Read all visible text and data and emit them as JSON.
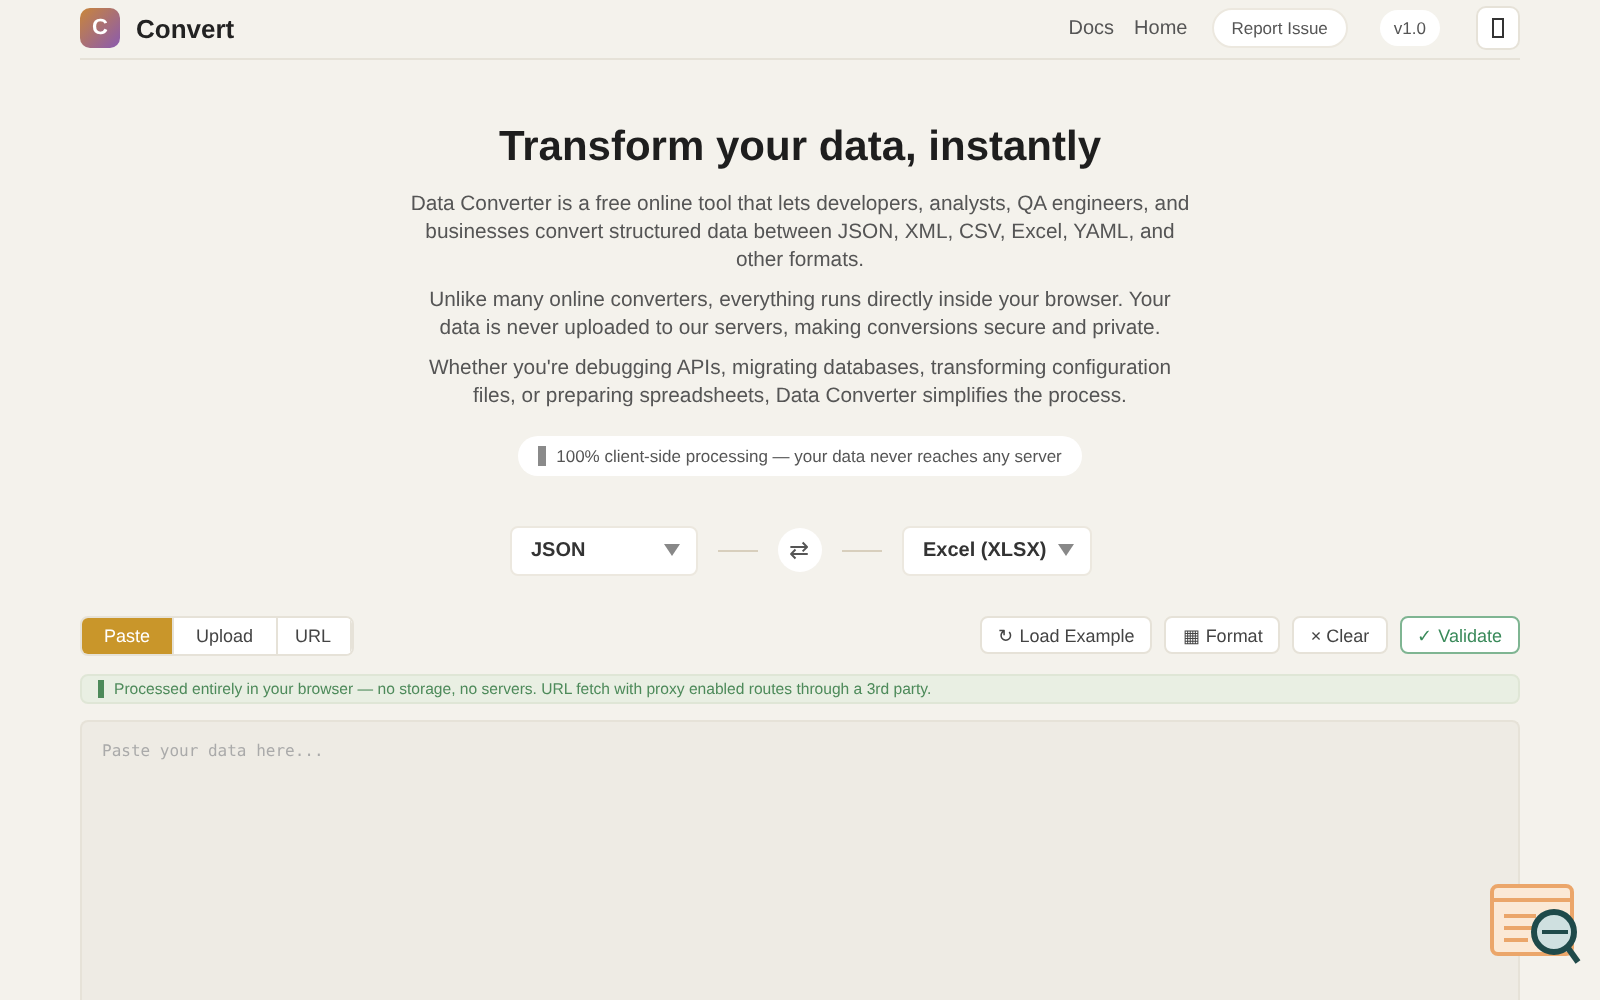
{
  "header": {
    "logo_letter": "C",
    "brand": "Convert",
    "nav": [
      "Docs",
      "Home"
    ],
    "report_button": "Report Issue",
    "version": "v1.0"
  },
  "hero": {
    "title": "Transform your data, instantly",
    "paragraphs": [
      "Data Converter is a free online tool that lets developers, analysts, QA engineers, and businesses convert structured data between JSON, XML, CSV, Excel, YAML, and other formats.",
      "Unlike many online converters, everything runs directly inside your browser. Your data is never uploaded to our servers, making conversions secure and private.",
      "Whether you're debugging APIs, migrating databases, transforming configuration files, or preparing spreadsheets, Data Converter simplifies the process."
    ],
    "badge": "100% client-side processing — your data never reaches any server"
  },
  "converter": {
    "from": "JSON",
    "swap": "⇄",
    "to": "Excel (XLSX)"
  },
  "input_tabs": [
    {
      "label": "Paste",
      "selected": true
    },
    {
      "label": "Upload",
      "selected": false
    },
    {
      "label": "URL",
      "selected": false
    }
  ],
  "actions": [
    {
      "icon": "↻",
      "label": "Load Example",
      "kind": "plain"
    },
    {
      "icon": "▦",
      "label": "Format",
      "kind": "plain"
    },
    {
      "icon": "×",
      "label": "Clear",
      "kind": "plain"
    },
    {
      "icon": "✓",
      "label": "Validate",
      "kind": "primary"
    }
  ],
  "notice": "Processed entirely in your browser — no storage, no servers. URL fetch with proxy enabled routes through a 3rd party.",
  "editor": {
    "placeholder": "Paste your data here..."
  }
}
